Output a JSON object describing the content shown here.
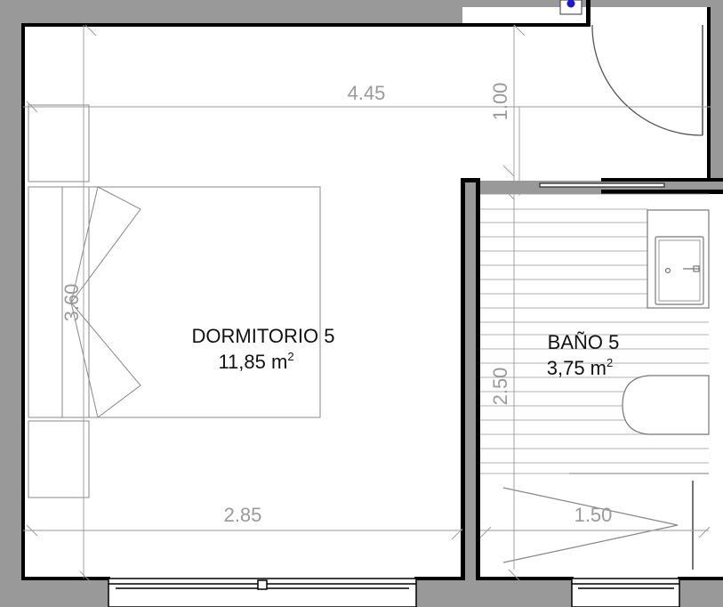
{
  "rooms": [
    {
      "name": "DORMITORIO 5",
      "area": "11,85 m",
      "area_unit_sup": "2"
    },
    {
      "name": "BAÑO 5",
      "area": "3,75 m",
      "area_unit_sup": "2"
    }
  ],
  "dimensions": {
    "bedroom_top_width": "4.45",
    "bedroom_bottom_width": "2.85",
    "bedroom_depth": "3.60",
    "corridor_depth": "1.00",
    "bath_depth": "2.50",
    "bath_width": "1.50"
  },
  "colors": {
    "background": "#999999",
    "floor": "#ffffff",
    "wall": "#000000",
    "dimension_line": "#9a9a9a",
    "fixture_line": "#888888",
    "marker": "#1a1ad6"
  }
}
